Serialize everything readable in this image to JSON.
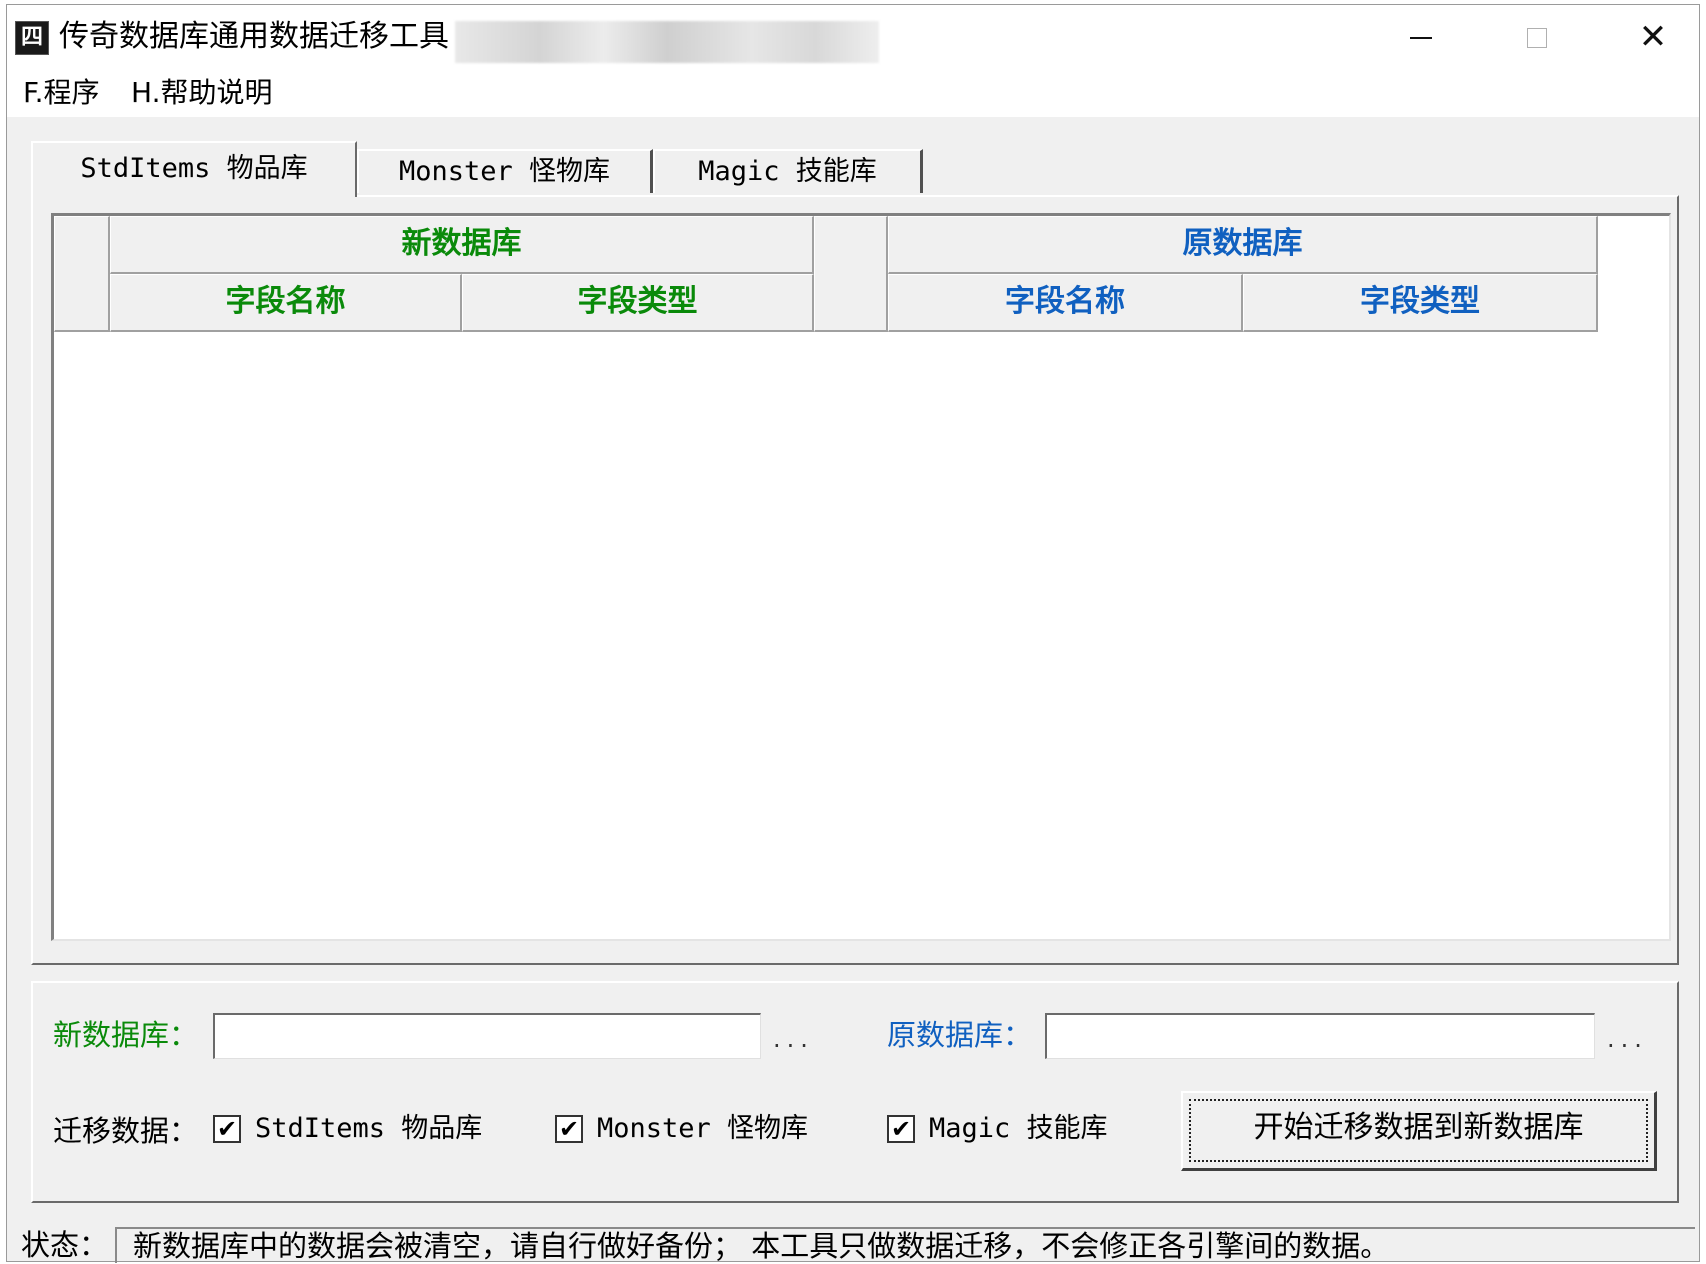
{
  "window": {
    "title": "传奇数据库通用数据迁移工具",
    "icon_glyph": "四"
  },
  "title_controls": {
    "minimize": "minimize-icon",
    "maximize": "maximize-icon",
    "close": "close-icon",
    "close_glyph": "✕"
  },
  "menu": {
    "items": [
      "F.程序",
      "H.帮助说明"
    ]
  },
  "tabs": [
    {
      "label": "StdItems 物品库",
      "active": true
    },
    {
      "label": "Monster 怪物库",
      "active": false
    },
    {
      "label": "Magic 技能库",
      "active": false
    }
  ],
  "grid": {
    "new_db_group": "新数据库",
    "old_db_group": "原数据库",
    "columns": {
      "new_field_name": "字段名称",
      "new_field_type": "字段类型",
      "old_field_name": "字段名称",
      "old_field_type": "字段类型"
    },
    "rows": []
  },
  "paths": {
    "new_db_label": "新数据库：",
    "new_db_value": "",
    "new_db_browse": "...",
    "old_db_label": "原数据库：",
    "old_db_value": "",
    "old_db_browse": "..."
  },
  "migrate": {
    "label": "迁移数据：",
    "options": [
      {
        "label": "StdItems 物品库",
        "checked": true
      },
      {
        "label": "Monster 怪物库",
        "checked": true
      },
      {
        "label": "Magic 技能库",
        "checked": true
      }
    ],
    "check_glyph": "✔",
    "start_button": "开始迁移数据到新数据库"
  },
  "status": {
    "label": "状态：",
    "message": "新数据库中的数据会被清空，请自行做好备份；    本工具只做数据迁移，不会修正各引擎间的数据。"
  },
  "colors": {
    "new_db": "#0a8a0a",
    "old_db": "#1060c0",
    "window_bg": "#f0f0f0"
  }
}
